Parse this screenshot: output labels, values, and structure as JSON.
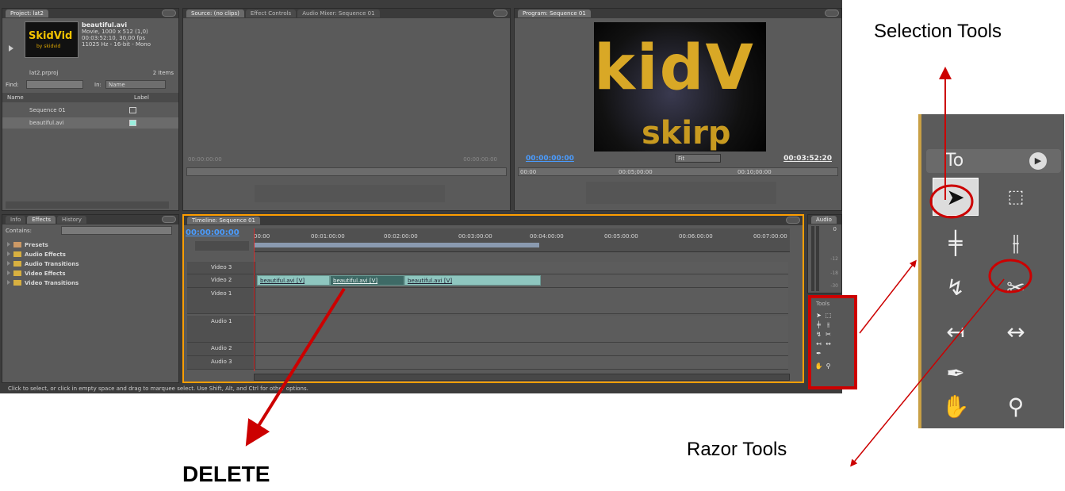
{
  "project": {
    "tab": "Project: lat2",
    "clip_name": "beautiful.avi",
    "clip_info1": "Movie, 1000 x 512 (1,0)",
    "clip_info2": "00:03:52:10, 30,00 fps",
    "clip_info3": "11025 Hz - 16-bit - Mono",
    "file": "lat2.prproj",
    "items": "2 Items",
    "find_label": "Find:",
    "in_label": "In:",
    "in_value": "Name",
    "col_name": "Name",
    "col_label": "Label",
    "rows": [
      "Sequence 01",
      "beautiful.avi"
    ],
    "thumb_text1": "SkidVid",
    "thumb_text2": "by skidvid"
  },
  "source": {
    "tabs": [
      "Source: (no clips)",
      "Effect Controls",
      "Audio Mixer: Sequence 01"
    ],
    "tc_left": "00:00:00:00",
    "tc_right": "00:00:00:00"
  },
  "program": {
    "tab": "Program: Sequence 01",
    "tc_left": "00:00:00:00",
    "fit": "Fit",
    "tc_right": "00:03:52:20",
    "ruler": [
      "00:00",
      "00:05;00:00",
      "00:10;00:00"
    ],
    "frame_text1": "kidV",
    "frame_text2": "skirp"
  },
  "effects": {
    "tabs": [
      "Info",
      "Effects",
      "History"
    ],
    "contains_label": "Contains:",
    "items": [
      "Presets",
      "Audio Effects",
      "Audio Transitions",
      "Video Effects",
      "Video Transitions"
    ]
  },
  "timeline": {
    "tab": "Timeline: Sequence 01",
    "timecode": "00:00:00:00",
    "ruler": [
      "00:00",
      "00:01:00:00",
      "00:02:00:00",
      "00:03:00:00",
      "00:04:00:00",
      "00:05:00:00",
      "00:06:00:00",
      "00:07:00:00"
    ],
    "tracks": [
      "Video 3",
      "Video 2",
      "Video 1",
      "Audio 1",
      "Audio 2",
      "Audio 3"
    ],
    "clips": [
      "beautiful.avi [V]",
      "beautiful.avi [V]",
      "beautiful.avi [V]"
    ]
  },
  "audio_meter": {
    "tab": "Audio",
    "levels": [
      "0",
      "-12",
      "-18",
      "-30"
    ]
  },
  "tools_small": {
    "tab": "Tools"
  },
  "status": "Click to select, or click in empty space and drag to marquee select. Use Shift, Alt, and Ctrl for other options.",
  "tools_big": {
    "tab": "To"
  },
  "annotations": {
    "selection": "Selection Tools",
    "razor": "Razor Tools",
    "delete": "DELETE"
  },
  "colors": {
    "accent": "#ff9e00",
    "timecode": "#4a9cff",
    "annotation": "#cc0000"
  }
}
